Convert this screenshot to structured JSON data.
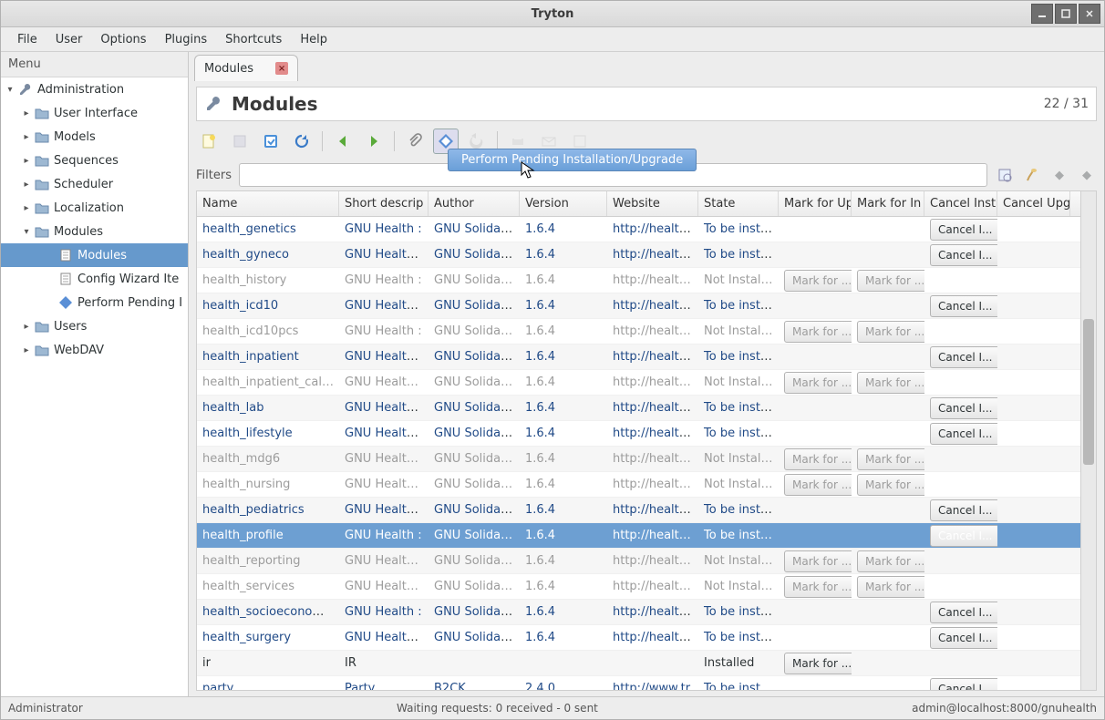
{
  "window": {
    "title": "Tryton"
  },
  "menubar": [
    "File",
    "User",
    "Options",
    "Plugins",
    "Shortcuts",
    "Help"
  ],
  "sidebar": {
    "header": "Menu",
    "root": {
      "label": "Administration",
      "expanded": true
    },
    "children": [
      {
        "label": "User Interface",
        "icon": "folder"
      },
      {
        "label": "Models",
        "icon": "folder"
      },
      {
        "label": "Sequences",
        "icon": "folder"
      },
      {
        "label": "Scheduler",
        "icon": "folder"
      },
      {
        "label": "Localization",
        "icon": "folder"
      },
      {
        "label": "Modules",
        "icon": "folder",
        "expanded": true,
        "children": [
          {
            "label": "Modules",
            "icon": "doc",
            "selected": true
          },
          {
            "label": "Config Wizard Ite",
            "icon": "doc"
          },
          {
            "label": "Perform Pending I",
            "icon": "gear"
          }
        ]
      },
      {
        "label": "Users",
        "icon": "folder"
      },
      {
        "label": "WebDAV",
        "icon": "folder"
      }
    ]
  },
  "tab": {
    "label": "Modules"
  },
  "page": {
    "title": "Modules",
    "count": "22 / 31"
  },
  "tooltip": "Perform Pending Installation/Upgrade",
  "filters": {
    "label": "Filters",
    "value": ""
  },
  "columns": [
    "Name",
    "Short descrip",
    "Author",
    "Version",
    "Website",
    "State",
    "Mark for Up",
    "Mark for In",
    "Cancel Inst",
    "Cancel Upg"
  ],
  "buttons": {
    "mark": "Mark for ...",
    "cancel": "Cancel I..."
  },
  "rows": [
    {
      "name": "health_genetics",
      "desc": "GNU Health :",
      "author": "GNU Solidario",
      "ver": "1.6.4",
      "web": "http://health.g",
      "state": "To be installe",
      "action": "cancel",
      "dim": false
    },
    {
      "name": "health_gyneco",
      "desc": "GNU Health: G",
      "author": "GNU Solidario",
      "ver": "1.6.4",
      "web": "http://health.g",
      "state": "To be installe",
      "action": "cancel",
      "dim": false
    },
    {
      "name": "health_history",
      "desc": "GNU Health :",
      "author": "GNU Solidario",
      "ver": "1.6.4",
      "web": "http://health.g",
      "state": "Not Installed",
      "action": "mark",
      "dim": true
    },
    {
      "name": "health_icd10",
      "desc": "GNU Health: I",
      "author": "GNU Solidario",
      "ver": "1.6.4",
      "web": "http://health.g",
      "state": "To be installe",
      "action": "cancel",
      "dim": false
    },
    {
      "name": "health_icd10pcs",
      "desc": "GNU Health :",
      "author": "GNU Solidario",
      "ver": "1.6.4",
      "web": "http://health.g",
      "state": "Not Installed",
      "action": "mark",
      "dim": true
    },
    {
      "name": "health_inpatient",
      "desc": "GNU Health: I",
      "author": "GNU Solidario",
      "ver": "1.6.4",
      "web": "http://health.g",
      "state": "To be installe",
      "action": "cancel",
      "dim": false
    },
    {
      "name": "health_inpatient_calen",
      "desc": "GNU Health: I",
      "author": "GNU Solidario",
      "ver": "1.6.4",
      "web": "http://health.g",
      "state": "Not Installed",
      "action": "mark",
      "dim": true
    },
    {
      "name": "health_lab",
      "desc": "GNU Health: L",
      "author": "GNU Solidario",
      "ver": "1.6.4",
      "web": "http://health.g",
      "state": "To be installe",
      "action": "cancel",
      "dim": false
    },
    {
      "name": "health_lifestyle",
      "desc": "GNU Health: L",
      "author": "GNU Solidario",
      "ver": "1.6.4",
      "web": "http://health.g",
      "state": "To be installe",
      "action": "cancel",
      "dim": false
    },
    {
      "name": "health_mdg6",
      "desc": "GNU Health : I",
      "author": "GNU Solidario",
      "ver": "1.6.4",
      "web": "http://health.g",
      "state": "Not Installed",
      "action": "mark",
      "dim": true
    },
    {
      "name": "health_nursing",
      "desc": "GNU Health : I",
      "author": "GNU Solidario",
      "ver": "1.6.4",
      "web": "http://health.g",
      "state": "Not Installed",
      "action": "mark",
      "dim": true
    },
    {
      "name": "health_pediatrics",
      "desc": "GNU Health: P",
      "author": "GNU Solidario",
      "ver": "1.6.4",
      "web": "http://health.g",
      "state": "To be installe",
      "action": "cancel",
      "dim": false
    },
    {
      "name": "health_profile",
      "desc": "GNU Health :",
      "author": "GNU Solidario",
      "ver": "1.6.4",
      "web": "http://health.g",
      "state": "To be installe",
      "action": "cancel",
      "dim": false,
      "selected": true
    },
    {
      "name": "health_reporting",
      "desc": "GNU Health : I",
      "author": "GNU Solidario",
      "ver": "1.6.4",
      "web": "http://health.g",
      "state": "Not Installed",
      "action": "mark",
      "dim": true
    },
    {
      "name": "health_services",
      "desc": "GNU Health : I",
      "author": "GNU Solidario",
      "ver": "1.6.4",
      "web": "http://health.g",
      "state": "Not Installed",
      "action": "mark",
      "dim": true
    },
    {
      "name": "health_socioeconomics",
      "desc": "GNU Health :",
      "author": "GNU Solidario",
      "ver": "1.6.4",
      "web": "http://health.g",
      "state": "To be installe",
      "action": "cancel",
      "dim": false
    },
    {
      "name": "health_surgery",
      "desc": "GNU Health: S",
      "author": "GNU Solidario",
      "ver": "1.6.4",
      "web": "http://health.g",
      "state": "To be installe",
      "action": "cancel",
      "dim": false
    },
    {
      "name": "ir",
      "desc": "IR",
      "author": "",
      "ver": "",
      "web": "",
      "state": "Installed",
      "action": "mark",
      "dim": false,
      "plain": true
    },
    {
      "name": "party",
      "desc": "Party",
      "author": "B2CK",
      "ver": "2.4.0",
      "web": "http://www.tr",
      "state": "To be installe",
      "action": "cancel",
      "dim": false
    }
  ],
  "status": {
    "left": "Administrator",
    "center": "Waiting requests: 0 received - 0 sent",
    "right": "admin@localhost:8000/gnuhealth"
  }
}
